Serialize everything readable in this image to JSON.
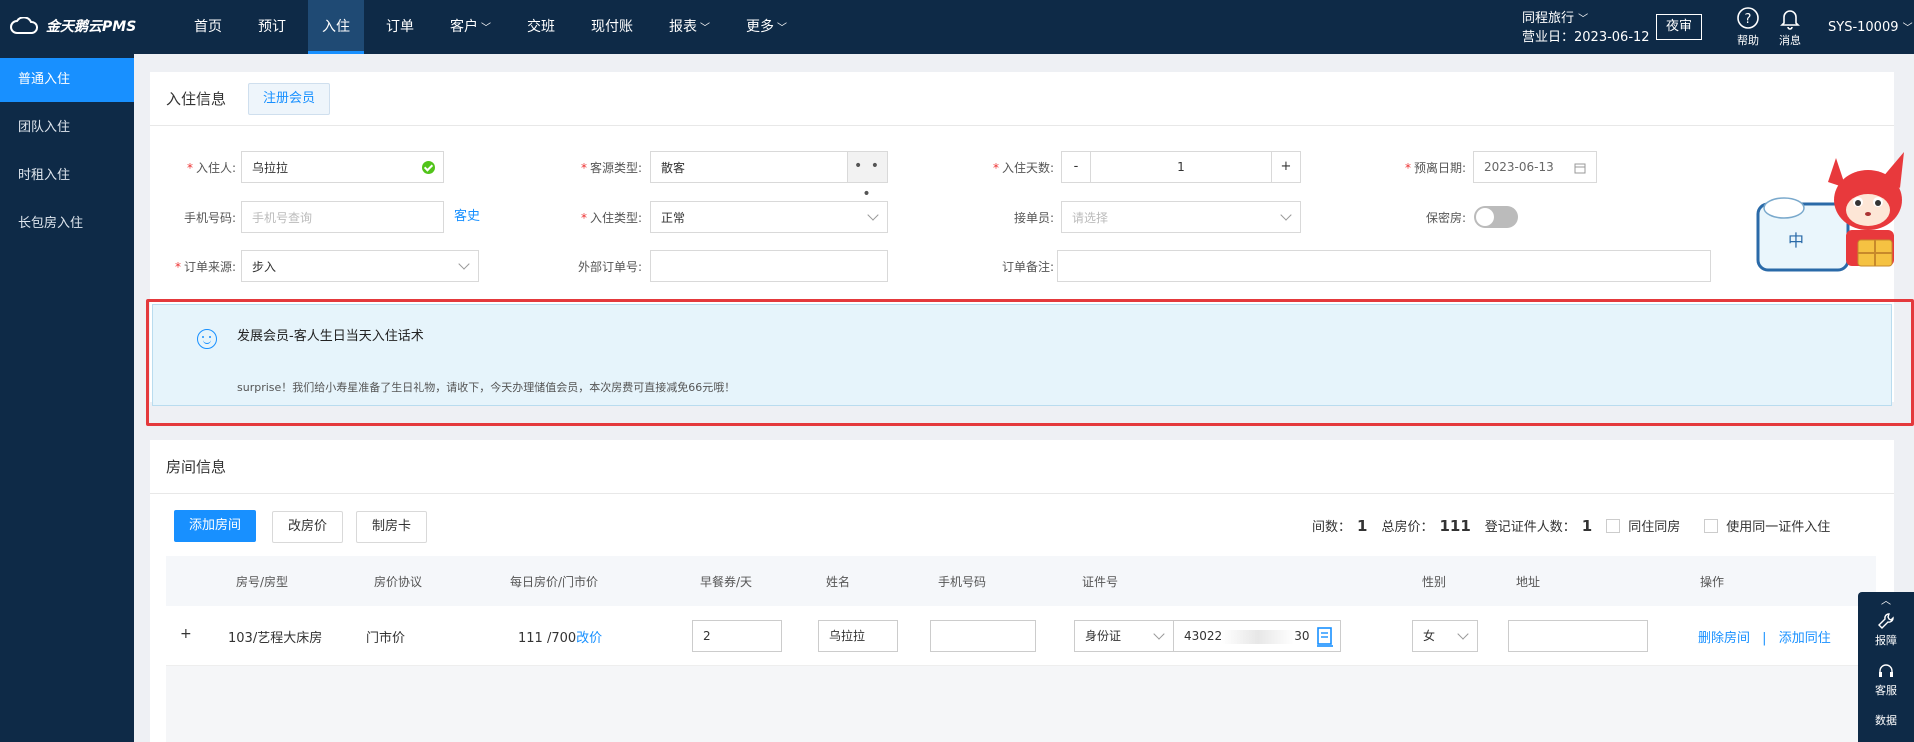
{
  "app": {
    "logo_text": "金天鹅云PMS"
  },
  "nav": [
    {
      "label": "首页",
      "dropdown": false
    },
    {
      "label": "预订",
      "dropdown": false
    },
    {
      "label": "入住",
      "dropdown": false,
      "active": true
    },
    {
      "label": "订单",
      "dropdown": false
    },
    {
      "label": "客户",
      "dropdown": true
    },
    {
      "label": "交班",
      "dropdown": false
    },
    {
      "label": "现付账",
      "dropdown": false
    },
    {
      "label": "报表",
      "dropdown": true
    },
    {
      "label": "更多",
      "dropdown": true
    }
  ],
  "header": {
    "hotel_name": "同程旅行",
    "business_day": "营业日：2023-06-12",
    "night_audit": "夜审",
    "help": "帮助",
    "messages": "消息",
    "user": "SYS-10009"
  },
  "sidebar": {
    "items": [
      {
        "label": "普通入住",
        "active": true
      },
      {
        "label": "团队入住"
      },
      {
        "label": "时租入住"
      },
      {
        "label": "长包房入住"
      }
    ]
  },
  "checkin": {
    "title": "入住信息",
    "register_member": "注册会员",
    "guest": {
      "label": "入住人:",
      "value": "乌拉拉"
    },
    "source_type": {
      "label": "客源类型:",
      "value": "散客",
      "more": "• • •"
    },
    "days": {
      "label": "入住天数:",
      "value": "1",
      "minus": "-",
      "plus": "+"
    },
    "departure": {
      "label": "预离日期:",
      "value": "2023-06-13"
    },
    "phone": {
      "label": "手机号码:",
      "placeholder": "手机号查询",
      "history": "客史"
    },
    "checkin_type": {
      "label": "入住类型:",
      "value": "正常"
    },
    "receiver": {
      "label": "接单员:",
      "placeholder": "请选择"
    },
    "private_room": {
      "label": "保密房:"
    },
    "order_source": {
      "label": "订单来源:",
      "value": "步入"
    },
    "external_order": {
      "label": "外部订单号:",
      "value": ""
    },
    "order_note": {
      "label": "订单备注:",
      "value": ""
    }
  },
  "tip": {
    "title": "发展会员-客人生日当天入住话术",
    "text": "surprise！我们给小寿星准备了生日礼物，请收下，今天办理储值会员，本次房费可直接减免66元哦！"
  },
  "mascot": {
    "sign_text": "中"
  },
  "rooms": {
    "title": "房间信息",
    "add_room": "添加房间",
    "change_price": "改房价",
    "make_card": "制房卡",
    "summary": {
      "rooms_label": "间数：",
      "rooms_value": "1",
      "total_label": "总房价：",
      "total_value": "111",
      "id_count_label": "登记证件人数：",
      "id_count_value": "1",
      "same_room": "同住同房",
      "same_id": "使用同一证件入住"
    },
    "columns": [
      "房号/房型",
      "房价协议",
      "每日房价/门市价",
      "早餐券/天",
      "姓名",
      "手机号码",
      "证件号",
      "性别",
      "地址",
      "操作"
    ],
    "row": {
      "expand": "+",
      "room": "103/艺程大床房",
      "agreement": "门市价",
      "price": "111 /700",
      "modify": "改价",
      "breakfast": "2",
      "name": "乌拉拉",
      "phone": "",
      "id_type": "身份证",
      "id_prefix": "43022",
      "id_suffix": "30",
      "gender": "女",
      "address": "",
      "delete": "删除房间",
      "sep": "|",
      "add_guest": "添加同住"
    }
  },
  "tools": [
    {
      "label": "报障",
      "icon": "wrench-icon"
    },
    {
      "label": "客服",
      "icon": "headset-icon"
    },
    {
      "label": "数据",
      "icon": "data-icon"
    }
  ],
  "colors": {
    "nav_bg": "#0e2a47",
    "primary": "#1890ff",
    "required": "#e33",
    "highlight_frame": "#e4393c"
  }
}
